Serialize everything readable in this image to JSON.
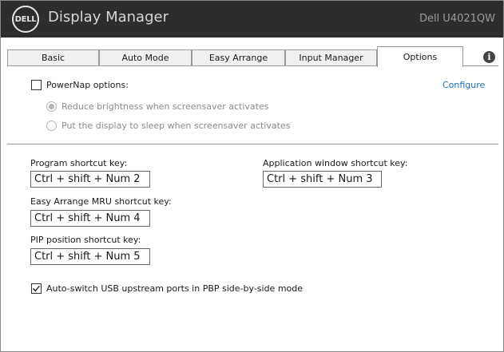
{
  "app": {
    "logo_text": "DELL",
    "title": "Display Manager",
    "model": "Dell U4021QW"
  },
  "tabs": [
    {
      "label": "Basic"
    },
    {
      "label": "Auto Mode"
    },
    {
      "label": "Easy Arrange"
    },
    {
      "label": "Input Manager"
    },
    {
      "label": "Options",
      "active": true
    }
  ],
  "options": {
    "powernap": {
      "label": "PowerNap options:",
      "checked": false,
      "configure_label": "Configure",
      "radio_reduce": "Reduce brightness when screensaver activates",
      "radio_sleep": "Put the display to sleep when screensaver activates"
    },
    "program_shortcut": {
      "label": "Program shortcut key:",
      "value": "Ctrl + shift + Num 2"
    },
    "app_window_shortcut": {
      "label": "Application window shortcut key:",
      "value": "Ctrl + shift + Num 3"
    },
    "easy_arrange_mru": {
      "label": "Easy Arrange MRU shortcut key:",
      "value": "Ctrl + shift + Num 4"
    },
    "pip_position": {
      "label": "PIP position shortcut key:",
      "value": "Ctrl + shift + Num 5"
    },
    "auto_switch_usb": {
      "label": "Auto-switch USB upstream ports in PBP side-by-side mode",
      "checked": true
    }
  },
  "colors": {
    "titlebar": "#2d2d2d",
    "link": "#1a6fb0"
  },
  "icons": {
    "info": "info-icon",
    "logo": "dell-logo"
  }
}
